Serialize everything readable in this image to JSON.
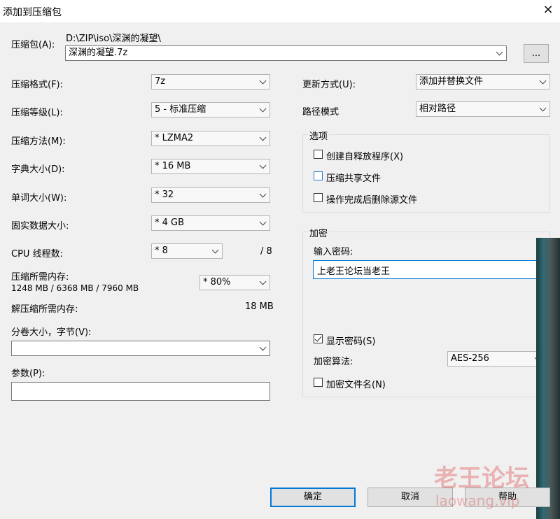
{
  "window": {
    "title": "添加到压缩包",
    "close_icon": "×"
  },
  "archive": {
    "label": "压缩包(A):",
    "path": "D:\\ZIP\\iso\\深渊的凝望\\",
    "name": "深渊的凝望.7z",
    "browse_label": "..."
  },
  "left": {
    "format_label": "压缩格式(F):",
    "format_value": "7z",
    "level_label": "压缩等级(L):",
    "level_value": "5 - 标准压缩",
    "method_label": "压缩方法(M):",
    "method_value": "* LZMA2",
    "dict_label": "字典大小(D):",
    "dict_value": "* 16 MB",
    "word_label": "单词大小(W):",
    "word_value": "* 32",
    "solid_label": "固实数据大小:",
    "solid_value": "* 4 GB",
    "threads_label": "CPU 线程数:",
    "threads_value": "* 8",
    "threads_total": "/ 8",
    "mem_label": "压缩所需内存:",
    "mem_detail": "1248 MB / 6368 MB / 7960 MB",
    "mem_percent": "* 80%",
    "decomp_label": "解压缩所需内存:",
    "decomp_value": "18 MB",
    "volume_label": "分卷大小，字节(V):",
    "volume_value": "",
    "params_label": "参数(P):",
    "params_value": ""
  },
  "right": {
    "update_label": "更新方式(U):",
    "update_value": "添加并替换文件",
    "path_label": "路径模式",
    "path_value": "相对路径",
    "options": {
      "title": "选项",
      "sfx_label": "创建自释放程序(X)",
      "shared_label": "压缩共享文件",
      "delete_label": "操作完成后删除源文件"
    },
    "encryption": {
      "title": "加密",
      "password_label": "输入密码:",
      "password_value": "上老王论坛当老王",
      "show_password_label": "显示密码(S)",
      "show_password_checked": true,
      "method_label": "加密算法:",
      "method_value": "AES-256",
      "encrypt_names_label": "加密文件名(N)"
    }
  },
  "buttons": {
    "ok": "确定",
    "cancel": "取消",
    "help": "帮助"
  },
  "watermark": {
    "text": "老王论坛",
    "url": "laowang.vip"
  }
}
